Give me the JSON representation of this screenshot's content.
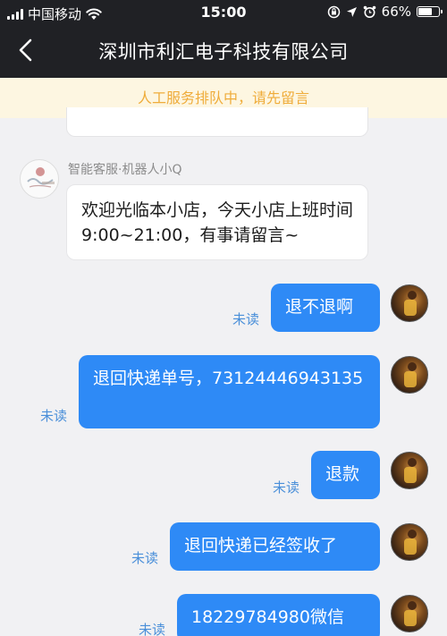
{
  "status_bar": {
    "carrier": "中国移动",
    "time": "15:00",
    "battery": "66%",
    "battery_level": 0.66
  },
  "nav": {
    "title": "深圳市利汇电子科技有限公司"
  },
  "notice": {
    "text": "人工服务排队中，请先留言"
  },
  "bot": {
    "name": "智能客服·机器人小Q",
    "message": "欢迎光临本小店，今天小店上班时间9:00~21:00，有事请留言~"
  },
  "messages": [
    {
      "text": "退不退啊",
      "status": "未读"
    },
    {
      "text": "退回快递单号，73124446943135",
      "status": "未读"
    },
    {
      "text": "退款",
      "status": "未读"
    },
    {
      "text": "退回快递已经签收了",
      "status": "未读"
    },
    {
      "text": "18229784980微信",
      "status": "未读"
    }
  ],
  "colors": {
    "header_bg": "#202125",
    "bubble_blue": "#2e8af6",
    "notice_text": "#efac3a",
    "notice_bg": "#fdf6e1"
  },
  "icons": [
    "back-arrow-icon",
    "wifi-icon",
    "signal-icon",
    "lock-rotation-icon",
    "location-icon",
    "alarm-icon",
    "battery-icon",
    "bot-avatar-icon",
    "user-avatar-icon"
  ]
}
